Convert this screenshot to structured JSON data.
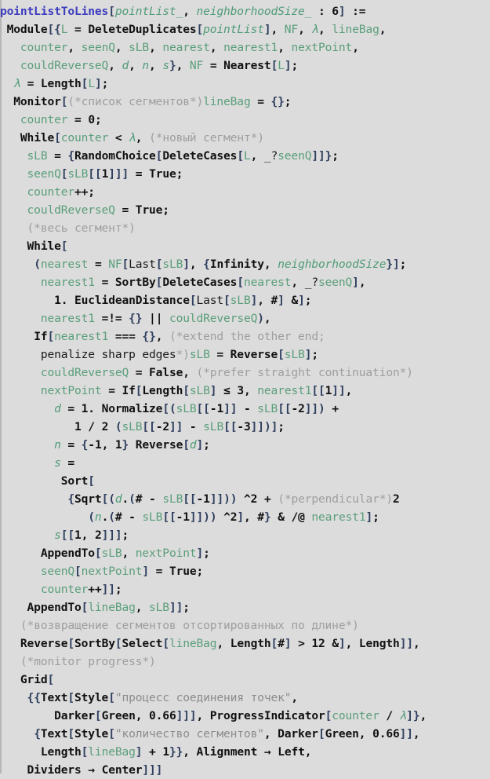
{
  "document": {
    "kind": "wolfram-language-notebook-input-cell",
    "language": "Wolfram Language",
    "background_color": "#dcdcdc",
    "cell_bracket_color": "#b6b6b6",
    "function_name": "pointListToLines"
  },
  "colors": {
    "user_function": "#3b3bbf",
    "builtin": "#111111",
    "local_variable": "#5a9e7a",
    "pattern": "#4f9b78",
    "bracket": "#2f3f5f",
    "comment": "#9e9e9e",
    "string": "#8c8c8c"
  },
  "code": {
    "lines": [
      {
        "id": 1,
        "indent": 0,
        "text": "pointListToLines[pointList_, neighborhoodSize_ : 6] :="
      },
      {
        "id": 2,
        "indent": 1,
        "text": " Module[{L = DeleteDuplicates[pointList], NF, λ, lineBag,"
      },
      {
        "id": 3,
        "indent": 3,
        "text": "   counter, seenQ, sLB, nearest, nearest1, nextPoint,"
      },
      {
        "id": 4,
        "indent": 3,
        "text": "   couldReverseQ, d, n, s}, NF = Nearest[L];"
      },
      {
        "id": 5,
        "indent": 2,
        "text": "  λ = Length[L];"
      },
      {
        "id": 6,
        "indent": 2,
        "text": "  Monitor[(*список сегментов*)lineBag = {};"
      },
      {
        "id": 7,
        "indent": 3,
        "text": "   counter = 0;"
      },
      {
        "id": 8,
        "indent": 3,
        "text": "   While[counter < λ, (*новый сегмент*)"
      },
      {
        "id": 9,
        "indent": 4,
        "text": "    sLB = {RandomChoice[DeleteCases[L, _?seenQ]]};"
      },
      {
        "id": 10,
        "indent": 4,
        "text": "    seenQ[sLB[[1]]] = True;"
      },
      {
        "id": 11,
        "indent": 4,
        "text": "    counter++;"
      },
      {
        "id": 12,
        "indent": 4,
        "text": "    couldReverseQ = True;"
      },
      {
        "id": 13,
        "indent": 4,
        "text": "    (*весь сегмент*)"
      },
      {
        "id": 14,
        "indent": 4,
        "text": "    While["
      },
      {
        "id": 15,
        "indent": 5,
        "text": "     (nearest = NF[Last[sLB], {Infinity, neighborhoodSize}];"
      },
      {
        "id": 16,
        "indent": 6,
        "text": "      nearest1 = SortBy[DeleteCases[nearest, _?seenQ],"
      },
      {
        "id": 17,
        "indent": 7,
        "text": "        1. EuclideanDistance[Last[sLB], #] &];"
      },
      {
        "id": 18,
        "indent": 6,
        "text": "      nearest1 =!= {} || couldReverseQ),"
      },
      {
        "id": 19,
        "indent": 5,
        "text": "     If[nearest1 === {}, (*extend the other end;"
      },
      {
        "id": 20,
        "indent": 5,
        "text": "      penalize sharp edges*)sLB = Reverse[sLB];"
      },
      {
        "id": 21,
        "indent": 6,
        "text": "      couldReverseQ = False, (*prefer straight continuation*)"
      },
      {
        "id": 22,
        "indent": 6,
        "text": "      nextPoint = If[Length[sLB] ≤ 3, nearest1[[1]],"
      },
      {
        "id": 23,
        "indent": 7,
        "text": "        d = 1. Normalize[(sLB[[-1]] - sLB[[-2]]) +"
      },
      {
        "id": 24,
        "indent": 9,
        "text": "           1 / 2 (sLB[[-2]] - sLB[[-3]])];"
      },
      {
        "id": 25,
        "indent": 8,
        "text": "        n = {-1, 1} Reverse[d];"
      },
      {
        "id": 26,
        "indent": 8,
        "text": "        s ="
      },
      {
        "id": 27,
        "indent": 9,
        "text": "         Sort["
      },
      {
        "id": 28,
        "indent": 10,
        "text": "          {Sqrt[(d.(# - sLB[[-1]])) ^2 + (*perpendicular*)2"
      },
      {
        "id": 29,
        "indent": 13,
        "text": "             (n.(# - sLB[[-1]])) ^2], #} & /@ nearest1];"
      },
      {
        "id": 30,
        "indent": 9,
        "text": "        s[[1, 2]]];"
      },
      {
        "id": 31,
        "indent": 7,
        "text": "      AppendTo[sLB, nextPoint];"
      },
      {
        "id": 32,
        "indent": 7,
        "text": "      seenQ[nextPoint] = True;"
      },
      {
        "id": 33,
        "indent": 7,
        "text": "      counter++]];"
      },
      {
        "id": 34,
        "indent": 4,
        "text": "    AppendTo[lineBag, sLB]];"
      },
      {
        "id": 35,
        "indent": 3,
        "text": "   (*возвращение сегментов отсортированных по длине*)"
      },
      {
        "id": 36,
        "indent": 3,
        "text": "   Reverse[SortBy[Select[lineBag, Length[#] > 12 &], Length]],"
      },
      {
        "id": 37,
        "indent": 3,
        "text": "   (*monitor progress*)"
      },
      {
        "id": 38,
        "indent": 3,
        "text": "   Grid["
      },
      {
        "id": 39,
        "indent": 4,
        "text": "    {{Text[Style[\"процесс соединения точек\","
      },
      {
        "id": 40,
        "indent": 7,
        "text": "        Darker[Green, 0.66]]], ProgressIndicator[counter / λ]},"
      },
      {
        "id": 41,
        "indent": 5,
        "text": "     {Text[Style[\"количество сегментов\", Darker[Green, 0.66]],"
      },
      {
        "id": 42,
        "indent": 6,
        "text": "      Length[lineBag] + 1}}, Alignment → Left,"
      },
      {
        "id": 43,
        "indent": 4,
        "text": "    Dividers → Center]]]"
      }
    ]
  },
  "tokens": {
    "user_functions": [
      "pointListToLines"
    ],
    "builtins": [
      "Module",
      "DeleteDuplicates",
      "Nearest",
      "Length",
      "Monitor",
      "While",
      "RandomChoice",
      "DeleteCases",
      "True",
      "False",
      "SortBy",
      "EuclideanDistance",
      "If",
      "Reverse",
      "Normalize",
      "Sort",
      "Sqrt",
      "AppendTo",
      "Select",
      "Grid",
      "Text",
      "Style",
      "Darker",
      "Green",
      "ProgressIndicator",
      "Alignment",
      "Left",
      "Dividers",
      "Center",
      "Infinity"
    ],
    "locals": [
      "L",
      "NF",
      "lineBag",
      "counter",
      "seenQ",
      "sLB",
      "nearest",
      "nearest1",
      "nextPoint",
      "couldReverseQ"
    ],
    "italic_locals": [
      "λ",
      "d",
      "n",
      "s"
    ],
    "patterns": [
      "pointList_",
      "neighborhoodSize_",
      "pointList",
      "neighborhoodSize"
    ],
    "comments": [
      "(*список сегментов*)",
      "(*новый сегмент*)",
      "(*весь сегмент*)",
      "(*extend the other end; penalize sharp edges*)",
      "(*prefer straight continuation*)",
      "(*perpendicular*)",
      "(*возвращение сегментов отсортированных по длине*)",
      "(*monitor progress*)"
    ],
    "strings": [
      "\"процесс соединения точек\"",
      "\"количество сегментов\""
    ],
    "numbers": [
      "6",
      "0",
      "1",
      "1.",
      "2",
      "3",
      "12",
      "-1",
      "-2",
      "-3",
      "0.66"
    ]
  }
}
